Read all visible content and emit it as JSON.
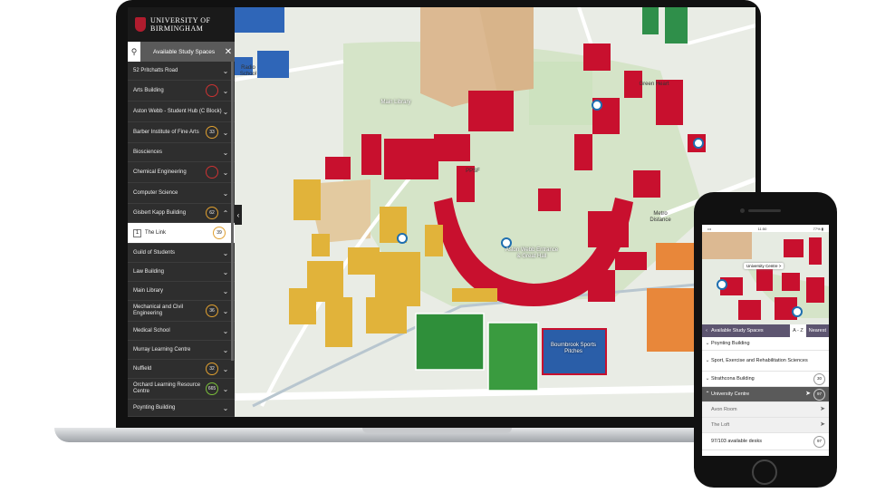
{
  "sidebar": {
    "logo_line1": "UNIVERSITY OF",
    "logo_line2": "BIRMINGHAM",
    "search_label": "Available Study Spaces",
    "close_glyph": "✕",
    "items": [
      {
        "label": "52 Pritchatts Road",
        "count": ""
      },
      {
        "label": "Arts Building",
        "count": ""
      },
      {
        "label": "Aston Webb - Student Hub (C Block)",
        "count": ""
      },
      {
        "label": "Barber Institute of Fine Arts",
        "count": "33"
      },
      {
        "label": "Biosciences",
        "count": ""
      },
      {
        "label": "Chemical Engineering",
        "count": ""
      },
      {
        "label": "Computer Science",
        "count": ""
      },
      {
        "label": "Gisbert Kapp Building",
        "count": "62"
      },
      {
        "label": "The Link",
        "count": "39",
        "index": "1"
      },
      {
        "label": "Guild of Students",
        "count": ""
      },
      {
        "label": "Law Building",
        "count": ""
      },
      {
        "label": "Main Library",
        "count": ""
      },
      {
        "label": "Mechanical and Civil Engineering",
        "count": "36"
      },
      {
        "label": "Medical School",
        "count": ""
      },
      {
        "label": "Murray Learning Centre",
        "count": ""
      },
      {
        "label": "Nuffield",
        "count": "32"
      },
      {
        "label": "Orchard Learning Resource Centre",
        "count": "665"
      },
      {
        "label": "Poynting Building",
        "count": ""
      }
    ]
  },
  "map": {
    "labels": {
      "main_library": "Main Library",
      "green_heart": "Green Heart",
      "aston_webb": "Aston Webb Entrance & Great Hall",
      "bournbrook": "Bournbrook Sports Pitches",
      "metro": "Metro Distance",
      "radio_school": "Radio School",
      "ppsf": "PPSF"
    }
  },
  "phone": {
    "status_time": "11:50",
    "status_right": "77% ▮",
    "map_popup": "University Centre >",
    "header_title": "Available Study Spaces",
    "tab_az": "A - Z",
    "tab_nearest": "Nearest",
    "rows": [
      {
        "label": "Poynting Building",
        "count": ""
      },
      {
        "label": "Sport, Exercise and Rehabilitation Sciences",
        "count": ""
      },
      {
        "label": "Strathcona Building",
        "count": "30"
      },
      {
        "label": "University Centre",
        "count": "97"
      },
      {
        "label": "Avon Room",
        "count": ""
      },
      {
        "label": "The Loft",
        "count": ""
      },
      {
        "label": "97/103 available desks",
        "count": "97"
      }
    ]
  },
  "colors": {
    "university_red": "#c8102e",
    "building_yellow": "#e1b33a",
    "building_orange": "#e8873a",
    "pitch_green": "#2f8f3a",
    "pitch_blue": "#2a5ea8",
    "sidebar_bg": "#2e2e2e",
    "phone_header": "#5d5570"
  }
}
